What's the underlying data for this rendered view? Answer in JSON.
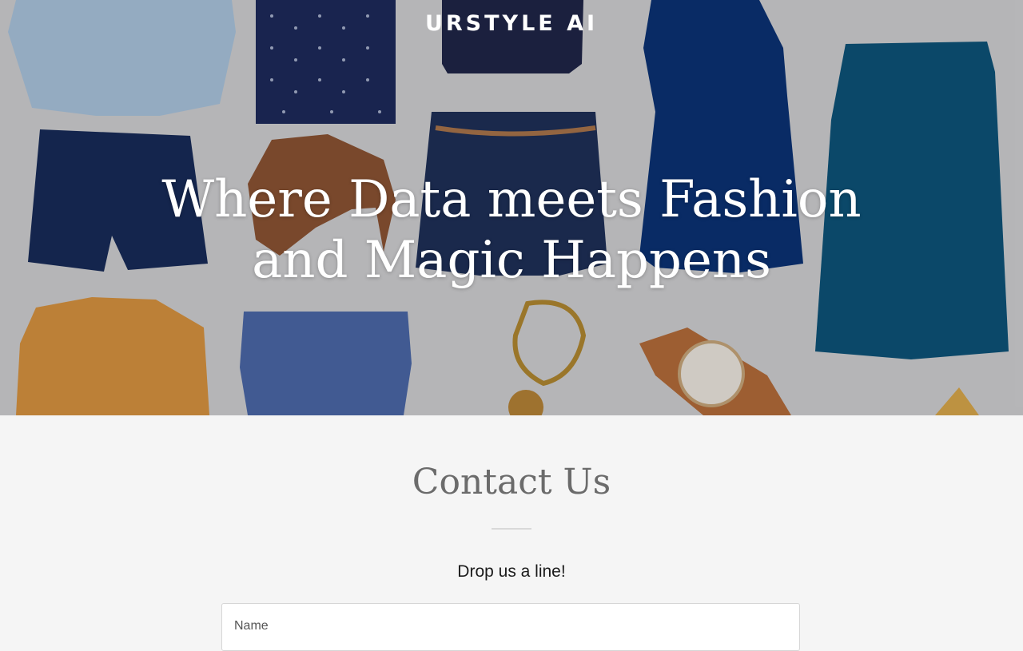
{
  "brand": {
    "name": "URSTYLE AI"
  },
  "hero": {
    "headline_line1": "Where Data meets Fashion",
    "headline_line2": "and Magic Happens"
  },
  "contact": {
    "title": "Contact Us",
    "subtitle": "Drop us a line!",
    "name_field": {
      "placeholder": "Name",
      "value": ""
    }
  },
  "colors": {
    "page_background": "#f5f5f5",
    "hero_text": "#ffffff",
    "contact_title": "#6b6b6b"
  }
}
